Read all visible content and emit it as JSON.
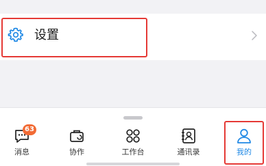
{
  "settings": {
    "label": "设置",
    "icon": "gear-icon",
    "chevron": "chevron-right-icon"
  },
  "tabbar": {
    "tabs": [
      {
        "id": "messages",
        "label": "消息",
        "icon": "chat-bubble-icon",
        "badge": "63",
        "active": false
      },
      {
        "id": "collab",
        "label": "协作",
        "icon": "briefcase-icon",
        "active": false
      },
      {
        "id": "workbench",
        "label": "工作台",
        "icon": "apps-grid-icon",
        "active": false
      },
      {
        "id": "contacts",
        "label": "通讯录",
        "icon": "contacts-book-icon",
        "active": false
      },
      {
        "id": "me",
        "label": "我的",
        "icon": "person-icon",
        "active": true
      }
    ]
  },
  "colors": {
    "accent": "#1e88e5",
    "highlight": "#e53935",
    "badge": "#f26b35"
  }
}
